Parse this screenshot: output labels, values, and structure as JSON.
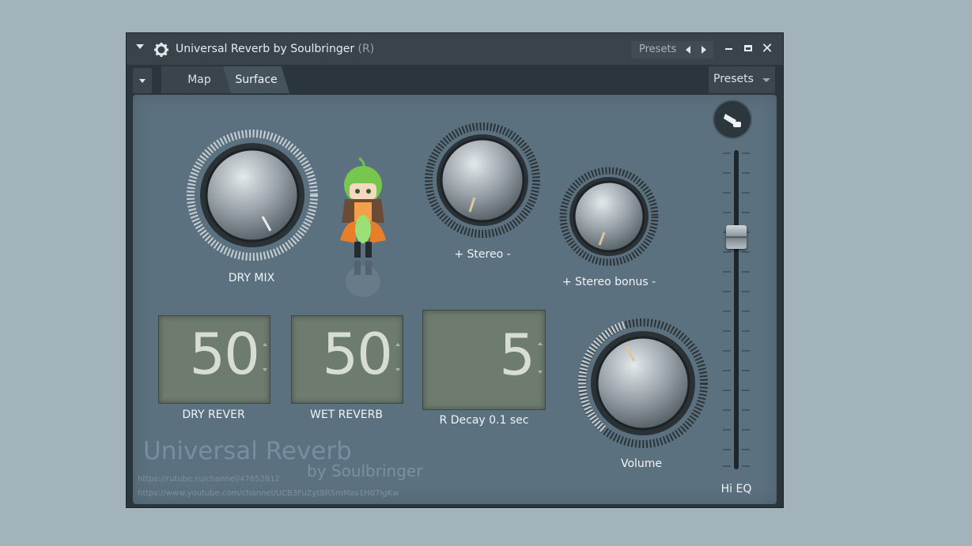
{
  "window": {
    "title": "Universal Reverb by Soulbringer",
    "title_suffix": "(R)",
    "presets_label": "Presets",
    "minimize_icon": "minimize-icon",
    "maximize_icon": "maximize-icon",
    "close_symbol": "✕"
  },
  "toolbar": {
    "tabs": [
      {
        "label": "Map"
      },
      {
        "label": "Surface"
      }
    ],
    "presets_label": "Presets"
  },
  "knobs": {
    "dry_mix": {
      "label": "DRY MIX"
    },
    "stereo": {
      "label": "+ Stereo -"
    },
    "stereo_bonus": {
      "label": "+ Stereo bonus -"
    },
    "volume": {
      "label": "Volume"
    }
  },
  "displays": {
    "dry_reverb": {
      "value": "50",
      "label": "DRY REVER"
    },
    "wet_reverb": {
      "value": "50",
      "label": "WET REVERB"
    },
    "decay": {
      "value": "5",
      "label": "R Decay 0.1 sec"
    }
  },
  "hi_eq": {
    "label": "Hi EQ"
  },
  "branding": {
    "title": "Universal Reverb",
    "subtitle": "by Soulbringer",
    "link1": "https://rutube.ru/channel/47652812",
    "link2": "https://www.youtube.com/channel/UCB3FuZyt8RSmMas1H07IgKw"
  },
  "colors": {
    "page_bg": "#a3b3bc",
    "panel_bg": "#5c717f",
    "window_bg": "#2b353c",
    "display_bg": "#6e7b6f"
  }
}
